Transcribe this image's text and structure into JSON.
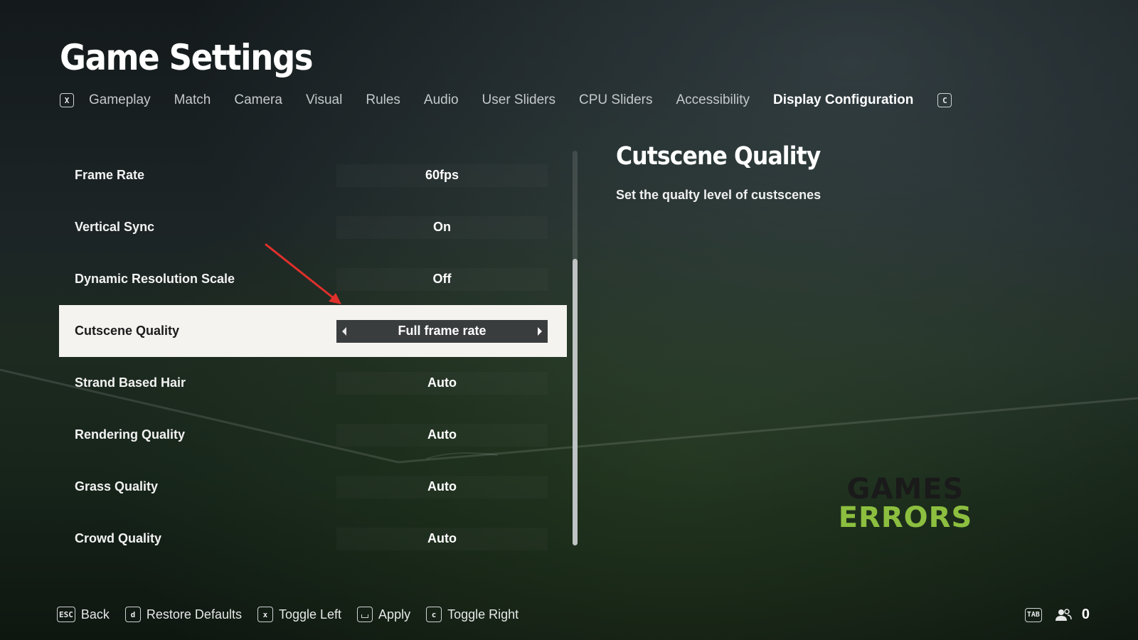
{
  "header": {
    "title": "Game Settings"
  },
  "tabs": {
    "left_key": "X",
    "right_key": "C",
    "items": [
      {
        "label": "Gameplay",
        "active": false
      },
      {
        "label": "Match",
        "active": false
      },
      {
        "label": "Camera",
        "active": false
      },
      {
        "label": "Visual",
        "active": false
      },
      {
        "label": "Rules",
        "active": false
      },
      {
        "label": "Audio",
        "active": false
      },
      {
        "label": "User Sliders",
        "active": false
      },
      {
        "label": "CPU Sliders",
        "active": false
      },
      {
        "label": "Accessibility",
        "active": false
      },
      {
        "label": "Display Configuration",
        "active": true
      }
    ]
  },
  "settings": [
    {
      "label": "Frame Rate",
      "value": "60fps"
    },
    {
      "label": "Vertical Sync",
      "value": "On"
    },
    {
      "label": "Dynamic Resolution Scale",
      "value": "Off"
    },
    {
      "label": "Cutscene Quality",
      "value": "Full frame rate",
      "selected": true
    },
    {
      "label": "Strand Based Hair",
      "value": "Auto"
    },
    {
      "label": "Rendering Quality",
      "value": "Auto"
    },
    {
      "label": "Grass Quality",
      "value": "Auto"
    },
    {
      "label": "Crowd Quality",
      "value": "Auto"
    }
  ],
  "detail": {
    "title": "Cutscene Quality",
    "description": "Set the qualty level of custscenes"
  },
  "watermark": {
    "line1": "GAMES",
    "line2": "ERRORS"
  },
  "footer": {
    "items": [
      {
        "key": "ESC",
        "label": "Back"
      },
      {
        "key": "d",
        "label": "Restore Defaults"
      },
      {
        "key": "x",
        "label": "Toggle Left"
      },
      {
        "key": "space",
        "label": "Apply"
      },
      {
        "key": "c",
        "label": "Toggle Right"
      }
    ],
    "friends_key": "TAB",
    "friends_count": "0"
  },
  "colors": {
    "selected_row_bg": "#f4f3ef",
    "annotation_arrow": "#e0302c",
    "watermark_green": "#8cbf3f"
  }
}
